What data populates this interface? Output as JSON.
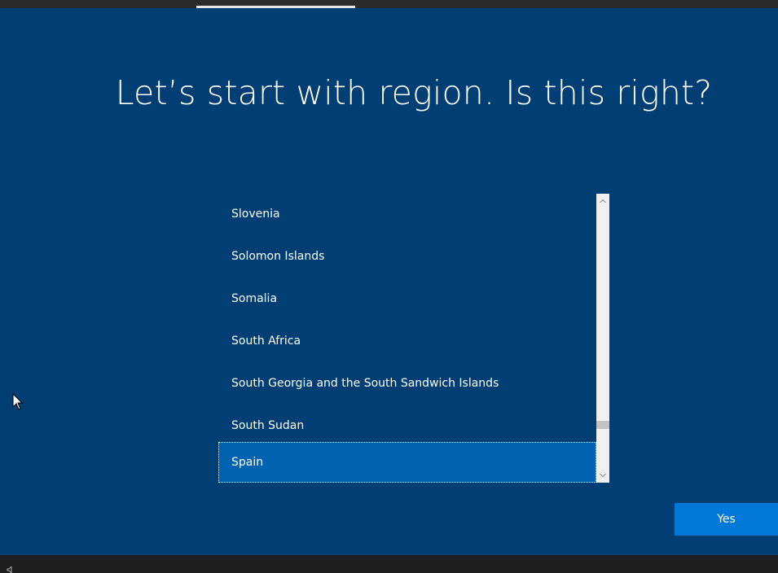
{
  "header": {
    "progress_step": 1,
    "progress_total": 5
  },
  "page": {
    "title": "Let’s start with region. Is this right?"
  },
  "region_list": {
    "items": [
      {
        "label": "Slovenia",
        "selected": false
      },
      {
        "label": "Solomon Islands",
        "selected": false
      },
      {
        "label": "Somalia",
        "selected": false
      },
      {
        "label": "South Africa",
        "selected": false
      },
      {
        "label": "South Georgia and the South Sandwich Islands",
        "selected": false
      },
      {
        "label": "South Sudan",
        "selected": false
      },
      {
        "label": "Spain",
        "selected": true
      }
    ],
    "selected_value": "Spain"
  },
  "buttons": {
    "yes_label": "Yes"
  },
  "colors": {
    "background": "#003e74",
    "selected_item": "#0063b1",
    "primary_button": "#0078d7",
    "scrollbar_track": "#f0f0f0",
    "taskbar": "#1f1f1f"
  },
  "icons": {
    "scroll_up": "chevron-up-icon",
    "scroll_down": "chevron-down-icon",
    "cursor": "mouse-pointer-icon",
    "taskbar": "volume-icon"
  }
}
